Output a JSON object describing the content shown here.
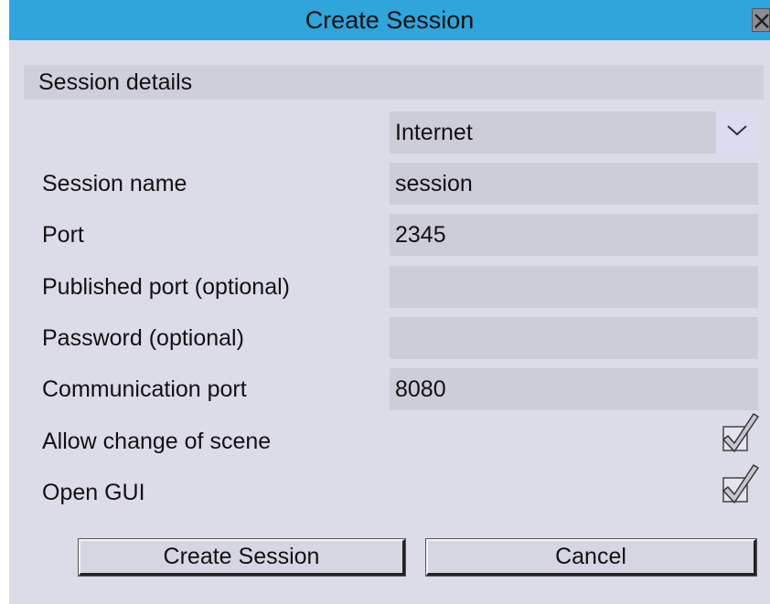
{
  "window": {
    "title": "Create Session"
  },
  "section": {
    "title": "Session details"
  },
  "network": {
    "selected": "Internet"
  },
  "fields": {
    "session_name": {
      "label": "Session name",
      "value": "session"
    },
    "port": {
      "label": "Port",
      "value": "2345"
    },
    "published_port": {
      "label": "Published port (optional)",
      "value": ""
    },
    "password": {
      "label": "Password (optional)",
      "value": ""
    },
    "communication_port": {
      "label": "Communication port",
      "value": "8080"
    }
  },
  "options": {
    "allow_scene_change": {
      "label": "Allow change of scene",
      "checked": true
    },
    "open_gui": {
      "label": "Open GUI",
      "checked": true
    }
  },
  "buttons": {
    "create": "Create Session",
    "cancel": "Cancel"
  },
  "colors": {
    "titlebar": "#2fa5dc",
    "background": "#dcdce8",
    "field": "#cdcdd8"
  },
  "icons": {
    "close": "close-icon",
    "dropdown": "chevron-down-icon",
    "check": "checkmark-icon"
  }
}
